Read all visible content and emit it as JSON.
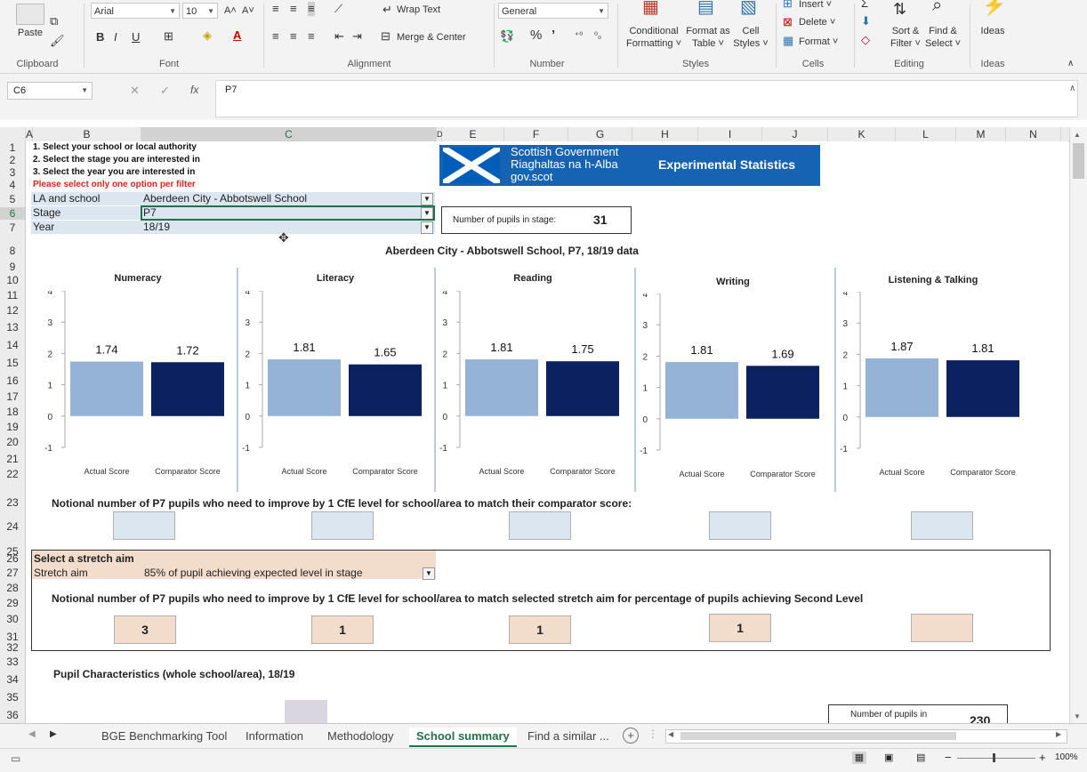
{
  "ribbon": {
    "clipboard": {
      "paste": "Paste",
      "label": "Clipboard"
    },
    "font": {
      "name": "Arial",
      "size": "10",
      "bold": "B",
      "italic": "I",
      "underline": "U",
      "grow": "A˄",
      "shrink": "A˅",
      "label": "Font"
    },
    "alignment": {
      "wrap": "Wrap Text",
      "merge": "Merge & Center",
      "label": "Alignment"
    },
    "number": {
      "format": "General",
      "percent": "%",
      "comma": "’",
      "label": "Number"
    },
    "styles": {
      "conditional": [
        "Conditional",
        "Formatting ˅"
      ],
      "table": [
        "Format as",
        "Table ˅"
      ],
      "cell": [
        "Cell",
        "Styles ˅"
      ],
      "label": "Styles"
    },
    "cells": {
      "insert": "Insert ˅",
      "delete": "Delete ˅",
      "format": "Format ˅",
      "label": "Cells"
    },
    "editing": {
      "sort": [
        "Sort &",
        "Filter ˅"
      ],
      "find": [
        "Find &",
        "Select ˅"
      ],
      "label": "Editing"
    },
    "ideas": {
      "btn": "Ideas",
      "label": "Ideas"
    }
  },
  "formula_bar": {
    "name_box": "C6",
    "cancel": "✕",
    "enter": "✓",
    "fx": "fx",
    "formula": "P7"
  },
  "columns": [
    "A",
    "B",
    "C",
    "D",
    "E",
    "F",
    "G",
    "H",
    "I",
    "J",
    "K",
    "L",
    "M",
    "N"
  ],
  "rows": [
    "1",
    "2",
    "3",
    "4",
    "5",
    "6",
    "7",
    "8",
    "9",
    "10",
    "11",
    "12",
    "13",
    "14",
    "15",
    "16",
    "17",
    "18",
    "19",
    "20",
    "21",
    "22",
    "23",
    "24",
    "25",
    "26",
    "27",
    "28",
    "29",
    "30",
    "31",
    "32",
    "33",
    "34",
    "35",
    "36"
  ],
  "instructions": [
    "1. Select your school or local authority",
    "2. Select the stage you are interested in",
    "3. Select the year you are interested in"
  ],
  "warning": "Please select only one option per filter",
  "selectors": [
    {
      "label": "LA and school",
      "value": "Aberdeen City - Abbotswell School"
    },
    {
      "label": "Stage",
      "value": "P7"
    },
    {
      "label": "Year",
      "value": "18/19"
    }
  ],
  "filter_icon": "filter-icon",
  "banner": {
    "line1": "Scottish Government",
    "line2": "Riaghaltas na h-Alba",
    "line3": "gov.scot",
    "tag": "Experimental Statistics",
    "color": "#1663b4"
  },
  "pupils_stage": {
    "label": "Number of pupils in stage:",
    "value": "31"
  },
  "report_title": "Aberdeen City - Abbotswell School, P7, 18/19 data",
  "colors": {
    "actual": "#95b3d7",
    "comparator": "#0b2160",
    "blue_cell": "#dce6f1",
    "peach_cell": "#f2dccb",
    "excel_green": "#217346"
  },
  "chart_data": [
    {
      "type": "bar",
      "title": "Numeracy",
      "categories": [
        "Actual Score",
        "Comparator Score"
      ],
      "values": [
        1.74,
        1.72
      ],
      "ylim": [
        -1,
        4
      ],
      "yticks": [
        "4",
        "3",
        "2",
        "1",
        "0",
        "-1"
      ]
    },
    {
      "type": "bar",
      "title": "Literacy",
      "categories": [
        "Actual Score",
        "Comparator Score"
      ],
      "values": [
        1.81,
        1.65
      ],
      "ylim": [
        -1,
        4
      ],
      "yticks": [
        "4",
        "3",
        "2",
        "1",
        "0",
        "-1"
      ]
    },
    {
      "type": "bar",
      "title": "Reading",
      "categories": [
        "Actual Score",
        "Comparator Score"
      ],
      "values": [
        1.81,
        1.75
      ],
      "ylim": [
        -1,
        4
      ],
      "yticks": [
        "4",
        "3",
        "2",
        "1",
        "0",
        "-1"
      ]
    },
    {
      "type": "bar",
      "title": "Writing",
      "categories": [
        "Actual Score",
        "Comparator Score"
      ],
      "values": [
        1.81,
        1.69
      ],
      "ylim": [
        -1,
        4
      ],
      "yticks": [
        "4",
        "3",
        "2",
        "1",
        "0",
        "-1"
      ]
    },
    {
      "type": "bar",
      "title": "Listening & Talking",
      "categories": [
        "Actual Score",
        "Comparator Score"
      ],
      "values": [
        1.87,
        1.81
      ],
      "ylim": [
        -1,
        4
      ],
      "yticks": [
        "4",
        "3",
        "2",
        "1",
        "0",
        "-1"
      ]
    }
  ],
  "notional_comparator": {
    "text": "Notional number of P7 pupils who need to improve by 1 CfE level for school/area to match their comparator score:",
    "values": [
      "",
      "",
      "",
      "",
      ""
    ]
  },
  "stretch": {
    "heading": "Select a stretch aim",
    "label": "Stretch aim",
    "value": "85% of pupil achieving expected level in stage",
    "text": "Notional number of P7 pupils who need to improve by 1 CfE level for school/area to match selected stretch aim for percentage of pupils achieving Second Level",
    "values": [
      "3",
      "1",
      "1",
      "1",
      ""
    ]
  },
  "characteristics": {
    "title": "Pupil Characteristics (whole school/area), 18/19",
    "pupils_label": "Number of pupils in",
    "pupils_value": "230"
  },
  "tabs": [
    "BGE Benchmarking Tool",
    "Information",
    "Methodology",
    "School summary",
    "Find a similar ..."
  ],
  "active_tab": "School summary",
  "status": {
    "zoom": "100%"
  }
}
